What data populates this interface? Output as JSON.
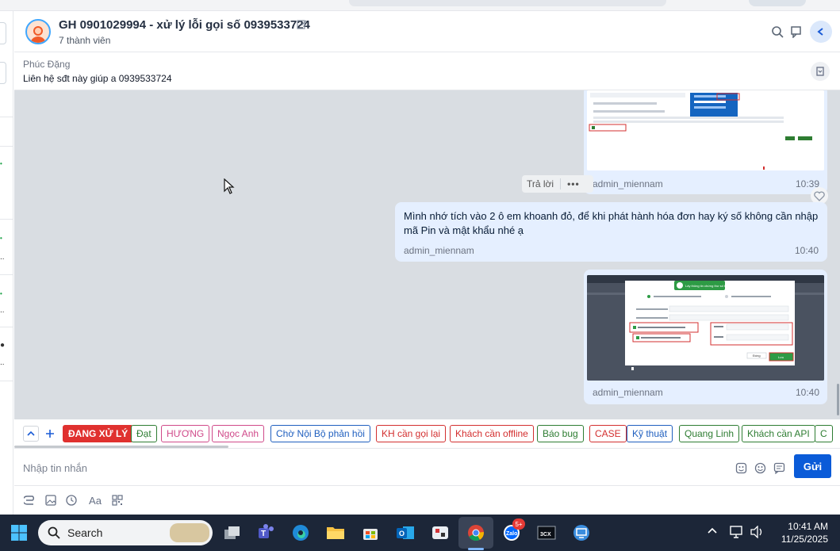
{
  "header": {
    "title": "GH 0901029994 - xử lý lỗi gọi số 0939533724",
    "members": "7 thành viên"
  },
  "pinned": {
    "sender": "Phúc Đặng",
    "text": "Liên hệ sđt này giúp a 0939533724"
  },
  "messages": [
    {
      "type": "image",
      "sender": "admin_miennam",
      "time": "10:39"
    },
    {
      "type": "text",
      "sender": "admin_miennam",
      "time": "10:40",
      "line1": "Mình nhớ tích vào 2 ô em khoanh đỏ, để khi phát hành hóa đơn hay ký số không cần nhập",
      "line2": "mã Pin và mật khẩu nhé ạ"
    },
    {
      "type": "image",
      "sender": "admin_miennam",
      "time": "10:40"
    }
  ],
  "reply": {
    "label": "Trả lời",
    "more": "•••"
  },
  "labels": [
    {
      "text": "ĐANG XỬ LÝ",
      "color": "#e0312f",
      "filled": true
    },
    {
      "text": "Đạt",
      "color": "#2e7d32"
    },
    {
      "text": "HƯƠNG",
      "color": "#d04a8a"
    },
    {
      "text": "Ngọc Anh",
      "color": "#d04a8a"
    },
    {
      "text": "Chờ Nội Bộ phản hồi",
      "color": "#1f5fbf"
    },
    {
      "text": "KH cần gọi lại",
      "color": "#d32f2f"
    },
    {
      "text": "Khách cần offline",
      "color": "#d32f2f"
    },
    {
      "text": "Báo bug",
      "color": "#2e7d32"
    },
    {
      "text": "CASE",
      "color": "#d32f2f"
    },
    {
      "text": "Kỹ thuật",
      "color": "#1f5fbf"
    },
    {
      "text": "Quang Linh",
      "color": "#2e7d32"
    },
    {
      "text": "Khách cần API",
      "color": "#2e7d32"
    },
    {
      "text": "C",
      "color": "#2e7d32"
    }
  ],
  "input": {
    "placeholder": "Nhập tin nhắn",
    "send_label": "Gửi"
  },
  "taskbar": {
    "search_label": "Search",
    "badge": "5+",
    "time": "10:41 AM",
    "date": "11/25/2025"
  },
  "thumb_text": {
    "dialog_title": "Lấy thông tin chứng thư số thành công",
    "close": "Đóng",
    "save": "Lưu"
  }
}
